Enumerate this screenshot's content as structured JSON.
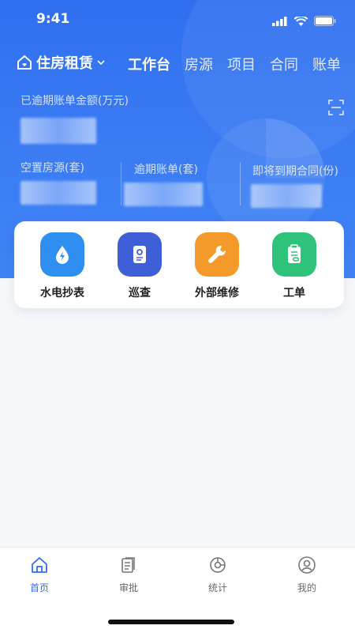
{
  "status_bar": {
    "time": "9:41"
  },
  "header": {
    "home_picker_label": "住房租赁",
    "tabs": [
      {
        "label": "工作台",
        "active": true
      },
      {
        "label": "房源",
        "active": false
      },
      {
        "label": "项目",
        "active": false
      },
      {
        "label": "合同",
        "active": false
      },
      {
        "label": "账单",
        "active": false
      }
    ],
    "overdue_amount_label": "已逾期账单金额(万元)",
    "stats": [
      {
        "label": "空置房源(套)"
      },
      {
        "label": "逾期账单(套)"
      },
      {
        "label": "即将到期合同(份)"
      }
    ]
  },
  "quick_actions": [
    {
      "label": "水电抄表",
      "icon": "water-drop-icon",
      "color": "#2f8ff0"
    },
    {
      "label": "巡查",
      "icon": "inspection-doc-icon",
      "color": "#3e5fd6"
    },
    {
      "label": "外部维修",
      "icon": "wrench-icon",
      "color": "#f49a2a"
    },
    {
      "label": "工单",
      "icon": "clipboard-icon",
      "color": "#2fc27a"
    }
  ],
  "bottom_nav": [
    {
      "label": "首页",
      "icon": "home-icon",
      "active": true
    },
    {
      "label": "审批",
      "icon": "approval-doc-icon",
      "active": false
    },
    {
      "label": "统计",
      "icon": "pie-chart-icon",
      "active": false
    },
    {
      "label": "我的",
      "icon": "user-icon",
      "active": false
    }
  ],
  "colors": {
    "primary": "#2f6ff0",
    "background": "#f6f7f9"
  }
}
